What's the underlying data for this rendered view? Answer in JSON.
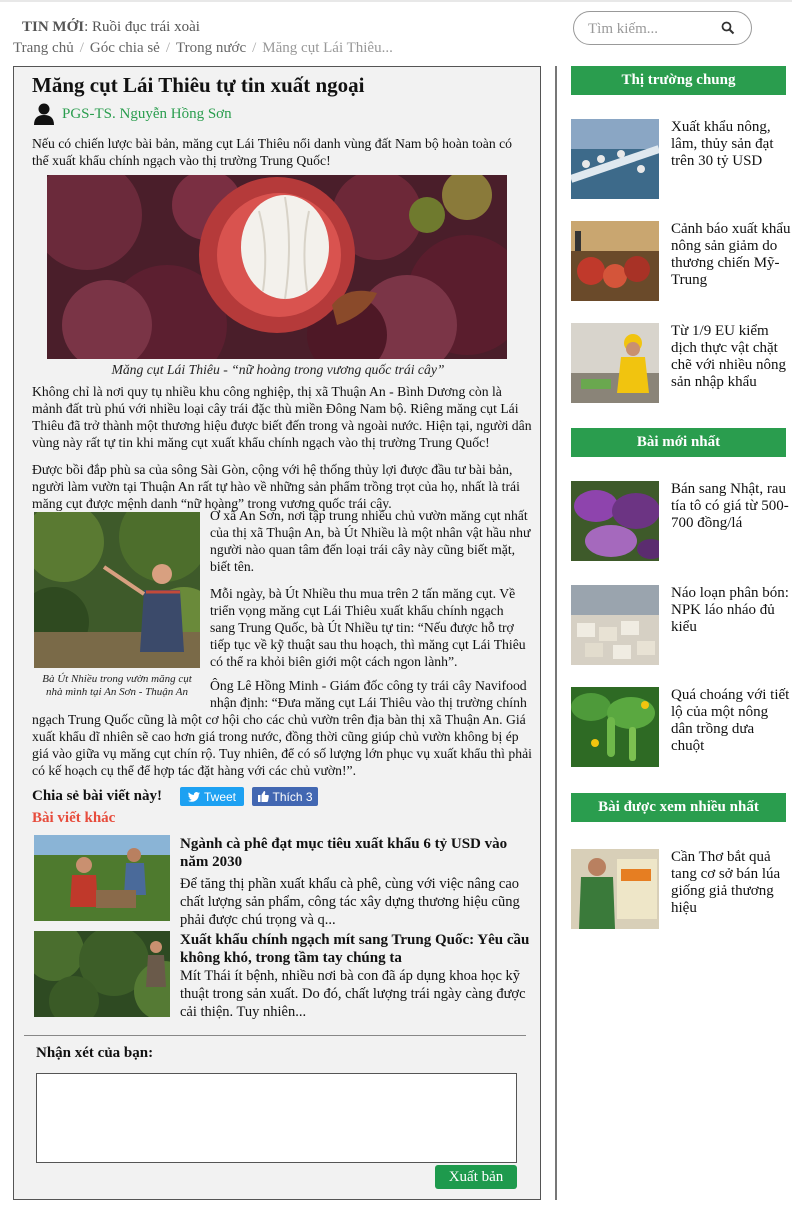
{
  "header": {
    "ticker_label": "TIN MỚI",
    "ticker_text": ": Ruồi đục trái xoài",
    "search_placeholder": "Tìm kiếm..."
  },
  "breadcrumb": [
    "Trang chủ",
    "Góc chia sẻ",
    "Trong nước",
    "Măng cụt Lái Thiêu..."
  ],
  "article": {
    "title": "Măng cụt Lái Thiêu tự tin xuất ngoại",
    "author": "PGS-TS. Nguyễn Hồng Sơn",
    "lead": "Nếu có chiến lược bài bản, măng cụt Lái Thiêu nổi danh vùng đất Nam bộ hoàn toàn có thể xuất khẩu chính ngạch vào thị trường Trung Quốc!",
    "hero_caption": "Măng cụt Lái Thiêu - “nữ hoàng trong vương quốc trái cây”",
    "para1": "Không chỉ là nơi quy tụ nhiều khu công nghiệp, thị xã Thuận An - Bình Dương còn là mảnh đất trù phú với nhiều loại cây trái đặc thù miền Đông Nam bộ. Riêng măng cụt Lái Thiêu đã trở thành một thương hiệu được biết đến trong và ngoài nước. Hiện tại, người dân vùng này rất tự tin khi măng cụt xuất khẩu chính ngạch vào thị trường Trung Quốc!",
    "para2": "Được bồi đắp phù sa của sông Sài Gòn, cộng với hệ thống thủy lợi được đầu tư bài bản, người làm vườn tại Thuận An rất tự hào về những sản phẩm trồng trọt của họ, nhất là trái măng cụt được mệnh danh “nữ hoàng” trong vương quốc trái cây.",
    "figure_caption": "Bà Út Nhiều trong vườn măng cụt nhà mình tại An Sơn - Thuận An",
    "para3": "Ở xã An Sơn, nơi tập trung nhiều chủ vườn măng cụt nhất của thị xã Thuận An, bà Út Nhiều là một nhân vật hầu như người nào quan tâm đến loại trái cây này cũng biết mặt, biết tên.",
    "para4": "Mỗi ngày, bà Út Nhiều thu mua trên 2 tấn măng cụt. Về triển vọng măng cụt Lái Thiêu xuất khẩu chính ngạch sang Trung Quốc, bà Út Nhiều tự tin: “Nếu được hỗ trợ tiếp tục về kỹ thuật sau thu hoạch, thì măng cụt Lái Thiêu có thể ra khỏi biên giới một cách ngon lành”.",
    "para5a": "Ông Lê Hồng Minh - Giám đốc công ty trái cây Navifood nhận định: “Đưa măng cụt Lái Thiêu vào thị trường chính",
    "para5b": "ngạch Trung Quốc cũng là một cơ hội cho các chủ vườn trên địa bàn thị xã Thuận An. Giá xuất khẩu dĩ nhiên sẽ cao hơn giá trong nước, đồng thời cũng giúp chủ vườn không bị ép giá vào giữa vụ măng cụt chín rộ. Tuy nhiên, để có số lượng lớn phục vụ xuất khẩu thì phải có kế hoạch cụ thể để hợp tác đặt hàng với các chủ vườn!”."
  },
  "share": {
    "label": "Chia sẻ bài viết này!",
    "tweet": "Tweet",
    "like": "Thích 3"
  },
  "other_articles": {
    "heading": "Bài viết khác",
    "items": [
      {
        "title": "Ngành cà phê đạt mục tiêu xuất khẩu 6 tỷ USD vào năm 2030",
        "desc": "Để tăng thị phần xuất khẩu cà phê, cùng với việc nâng cao chất lượng sản phẩm, công tác xây dựng thương hiệu cũng phải được chú trọng và q..."
      },
      {
        "title": "Xuất khẩu chính ngạch mít sang Trung Quốc: Yêu cầu không khó, trong tầm tay chúng ta",
        "desc": "Mít Thái ít bệnh, nhiều nơi bà con đã áp dụng khoa học kỹ thuật trong sản xuất. Do đó, chất lượng trái ngày càng được cải thiện. Tuy nhiên..."
      }
    ]
  },
  "comment": {
    "label": "Nhận xét của bạn:",
    "submit": "Xuất bản"
  },
  "sidebar": {
    "sections": [
      {
        "heading": "Thị trường chung",
        "items": [
          "Xuất khẩu nông, lâm, thủy sản đạt trên 30 tỷ USD",
          "Cảnh báo xuất khẩu nông sản giảm do thương chiến Mỹ-Trung",
          "Từ 1/9 EU kiểm dịch thực vật chặt chẽ với nhiều nông sản nhập khẩu"
        ]
      },
      {
        "heading": "Bài mới nhất",
        "items": [
          "Bán sang Nhật, rau tía tô có giá từ 500-700 đồng/lá",
          "Náo loạn phân bón: NPK láo nháo đủ kiểu",
          "Quá choáng với tiết lộ của một nông dân trồng dưa chuột"
        ]
      },
      {
        "heading": "Bài được xem nhiều nhất",
        "items": [
          "Cần Thơ bắt quả tang cơ sở bán lúa giống giả thương hiệu"
        ]
      }
    ]
  },
  "colors": {
    "accent_green": "#2a9d4e",
    "other_articles_red": "#e74c3c",
    "twitter_blue": "#1da1f2",
    "facebook_blue": "#4267b2"
  }
}
